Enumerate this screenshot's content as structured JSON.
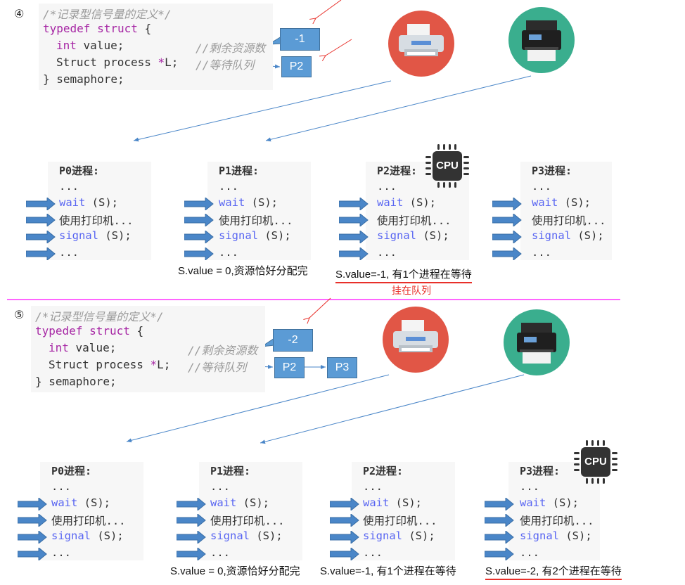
{
  "sections": [
    {
      "step": "④",
      "code": {
        "comment_title": "/*记录型信号量的定义*/",
        "line1_kw": "typedef struct",
        "line1_rest": " {",
        "line2_kw": "int",
        "line2_rest": " value;",
        "line2_comment": "//剩余资源数",
        "line3_code": "Struct process ",
        "line3_star": "*",
        "line3_rest": "L;",
        "line3_comment": "//等待队列",
        "line4": "} semaphore;"
      },
      "value_box": "-1",
      "queue": [
        "P2"
      ],
      "processes": [
        {
          "title": "P0进程:",
          "cpu": false
        },
        {
          "title": "P1进程:",
          "cpu": false
        },
        {
          "title": "P2进程:",
          "cpu": true
        },
        {
          "title": "P3进程:",
          "cpu": false
        }
      ],
      "notes": [
        "S.value = 0,资源恰好分配完",
        "S.value=-1, 有1个进程在等待"
      ],
      "extra_note": "挂在队列"
    },
    {
      "step": "⑤",
      "code": {
        "comment_title": "/*记录型信号量的定义*/",
        "line1_kw": "typedef struct",
        "line1_rest": " {",
        "line2_kw": "int",
        "line2_rest": " value;",
        "line2_comment": "//剩余资源数",
        "line3_code": "Struct process ",
        "line3_star": "*",
        "line3_rest": "L;",
        "line3_comment": "//等待队列",
        "line4": "} semaphore;"
      },
      "value_box": "-2",
      "queue": [
        "P2",
        "P3"
      ],
      "processes": [
        {
          "title": "P0进程:",
          "cpu": false
        },
        {
          "title": "P1进程:",
          "cpu": false
        },
        {
          "title": "P2进程:",
          "cpu": false
        },
        {
          "title": "P3进程:",
          "cpu": true
        }
      ],
      "notes": [
        "S.value = 0,资源恰好分配完",
        "S.value=-1, 有1个进程在等待",
        "S.value=-2, 有2个进程在等待"
      ]
    }
  ],
  "process_lines": {
    "dots": "...",
    "wait_kw": "wait",
    "wait_rest": " (S);",
    "use": "使用打印机...",
    "signal_kw": "signal",
    "signal_rest": " (S);",
    "end": "..."
  },
  "cpu_label": "CPU",
  "colors": {
    "box": "#5b9bd5",
    "printer1": "#e15646",
    "printer2": "#3aae8e",
    "keyword": "#a626a4",
    "call": "#5865f2",
    "divider": "#ff33ff",
    "underline": "#e8302a"
  }
}
